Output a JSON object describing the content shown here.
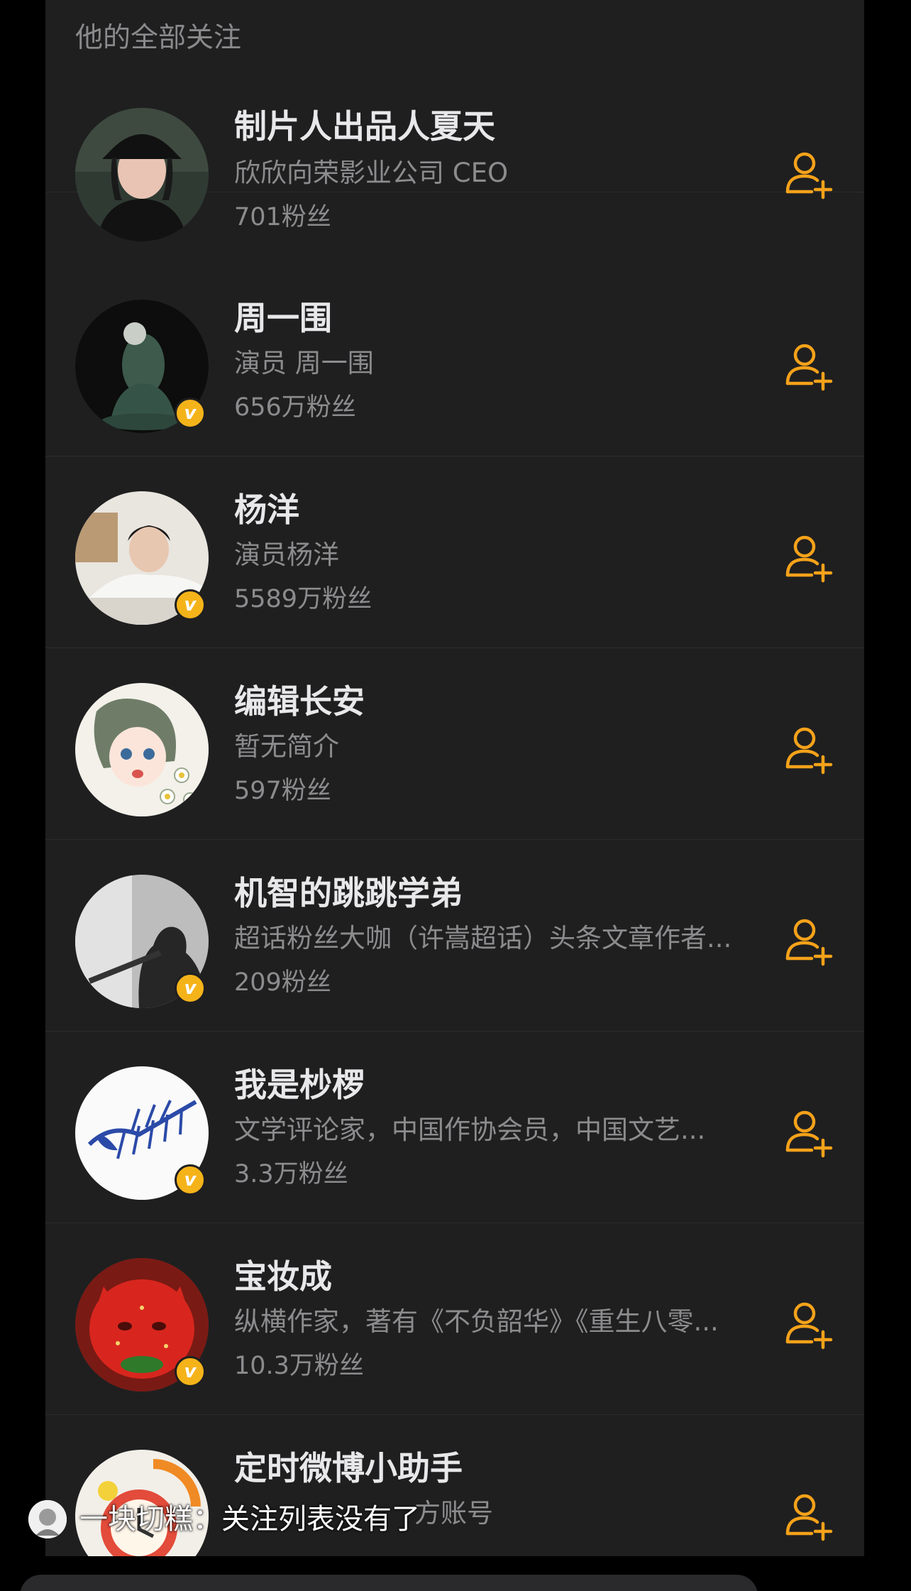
{
  "section_title": "他的全部关注",
  "accent_color": "#f5a21a",
  "follow_icon": "add-user-icon",
  "verified_icon": "verified-v-badge",
  "users": [
    {
      "name": "制片人出品人夏天",
      "desc": "欣欣向荣影业公司 CEO",
      "fans": "701粉丝",
      "verified": false,
      "avatar": "woman-black-bucket-hat"
    },
    {
      "name": "周一围",
      "desc": "演员 周一围",
      "fans": "656万粉丝",
      "verified": true,
      "avatar": "jade-sculpture"
    },
    {
      "name": "杨洋",
      "desc": "演员杨洋",
      "fans": "5589万粉丝",
      "verified": true,
      "avatar": "man-white-shirt"
    },
    {
      "name": "编辑长安",
      "desc": "暂无简介",
      "fans": "597粉丝",
      "verified": false,
      "avatar": "illustrated-girl-flowers"
    },
    {
      "name": "机智的跳跳学弟",
      "desc": "超话粉丝大咖（许嵩超话）头条文章作者...",
      "fans": "209粉丝",
      "verified": true,
      "avatar": "silhouette-guitar"
    },
    {
      "name": "我是杪椤",
      "desc": "文学评论家，中国作协会员，中国文艺...",
      "fans": "3.3万粉丝",
      "verified": true,
      "avatar": "fish-skeleton-drawing"
    },
    {
      "name": "宝妆成",
      "desc": "纵横作家，著有《不负韶华》《重生八零...",
      "fans": "10.3万粉丝",
      "verified": true,
      "avatar": "strawberry-cat"
    },
    {
      "name": "定时微博小助手",
      "desc": "方账号",
      "fans": "",
      "verified": false,
      "avatar": "alarm-clock"
    }
  ],
  "subtitle": {
    "speaker": "一块切糕：",
    "text": "关注列表没有了"
  }
}
